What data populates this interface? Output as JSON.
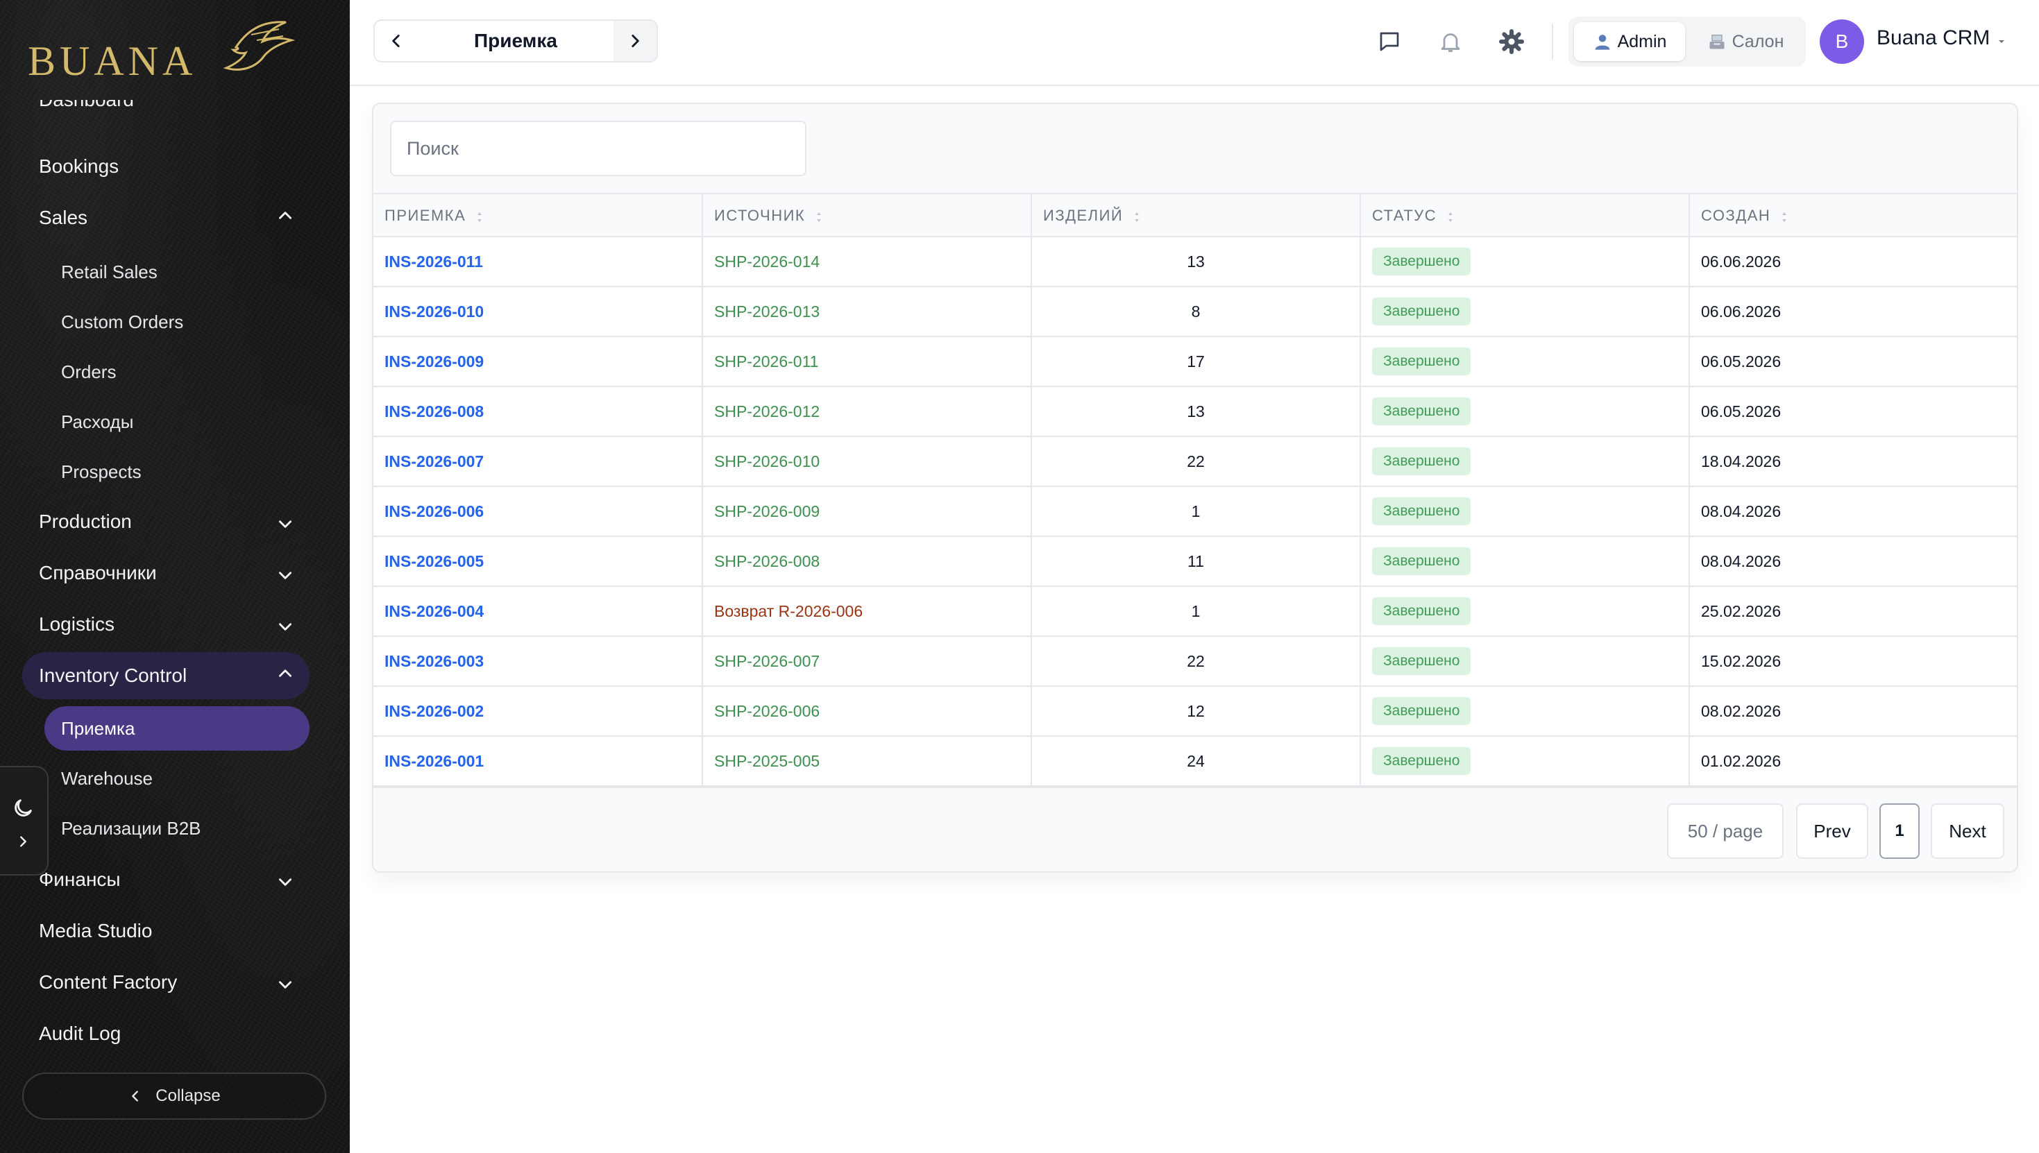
{
  "brand": {
    "logo_text": "BUANA"
  },
  "sidebar": {
    "items": [
      {
        "label": "Dashboard"
      },
      {
        "label": "Bookings"
      },
      {
        "label": "Sales"
      },
      {
        "label": "Production"
      },
      {
        "label": "Справочники"
      },
      {
        "label": "Logistics"
      },
      {
        "label": "Inventory Control"
      },
      {
        "label": "Финансы"
      },
      {
        "label": "Media Studio"
      },
      {
        "label": "Content Factory"
      },
      {
        "label": "Audit Log"
      }
    ],
    "sales_sub": [
      "Retail Sales",
      "Custom Orders",
      "Orders",
      "Расходы",
      "Prospects"
    ],
    "inventory_sub": [
      "Приемка",
      "Warehouse",
      "Реализации B2B"
    ],
    "collapse_label": "Collapse"
  },
  "header": {
    "page_title": "Приемка",
    "roles": {
      "admin": "Admin",
      "salon": "Салон"
    },
    "user": {
      "initial": "B",
      "name": "Buana CRM"
    }
  },
  "search": {
    "placeholder": "Поиск",
    "value": ""
  },
  "table": {
    "columns": [
      "ПРИЕМКА",
      "ИСТОЧНИК",
      "ИЗДЕЛИЙ",
      "СТАТУС",
      "СОЗДАН"
    ],
    "rows": [
      {
        "id": "INS-2026-011",
        "source": "SHP-2026-014",
        "items": "13",
        "status": "Завершено",
        "created": "06.06.2026"
      },
      {
        "id": "INS-2026-010",
        "source": "SHP-2026-013",
        "items": "8",
        "status": "Завершено",
        "created": "06.06.2026"
      },
      {
        "id": "INS-2026-009",
        "source": "SHP-2026-011",
        "items": "17",
        "status": "Завершено",
        "created": "06.05.2026"
      },
      {
        "id": "INS-2026-008",
        "source": "SHP-2026-012",
        "items": "13",
        "status": "Завершено",
        "created": "06.05.2026"
      },
      {
        "id": "INS-2026-007",
        "source": "SHP-2026-010",
        "items": "22",
        "status": "Завершено",
        "created": "18.04.2026"
      },
      {
        "id": "INS-2026-006",
        "source": "SHP-2026-009",
        "items": "1",
        "status": "Завершено",
        "created": "08.04.2026"
      },
      {
        "id": "INS-2026-005",
        "source": "SHP-2026-008",
        "items": "11",
        "status": "Завершено",
        "created": "08.04.2026"
      },
      {
        "id": "INS-2026-004",
        "source": "Возврат R-2026-006",
        "items": "1",
        "status": "Завершено",
        "created": "25.02.2026"
      },
      {
        "id": "INS-2026-003",
        "source": "SHP-2026-007",
        "items": "22",
        "status": "Завершено",
        "created": "15.02.2026"
      },
      {
        "id": "INS-2026-002",
        "source": "SHP-2026-006",
        "items": "12",
        "status": "Завершено",
        "created": "08.02.2026"
      },
      {
        "id": "INS-2026-001",
        "source": "SHP-2025-005",
        "items": "24",
        "status": "Завершено",
        "created": "01.02.2026"
      }
    ]
  },
  "pagination": {
    "page_size": "50 / page",
    "prev": "Prev",
    "current": "1",
    "next": "Next"
  },
  "colors": {
    "accent_purple": "#7c5ce6",
    "link_blue": "#2563eb",
    "source_green": "#3f8f4e",
    "return_brown": "#9a3412",
    "status_bg": "#dcf3e2",
    "status_text": "#3f9b56",
    "logo_gold": "#d4b96a"
  }
}
